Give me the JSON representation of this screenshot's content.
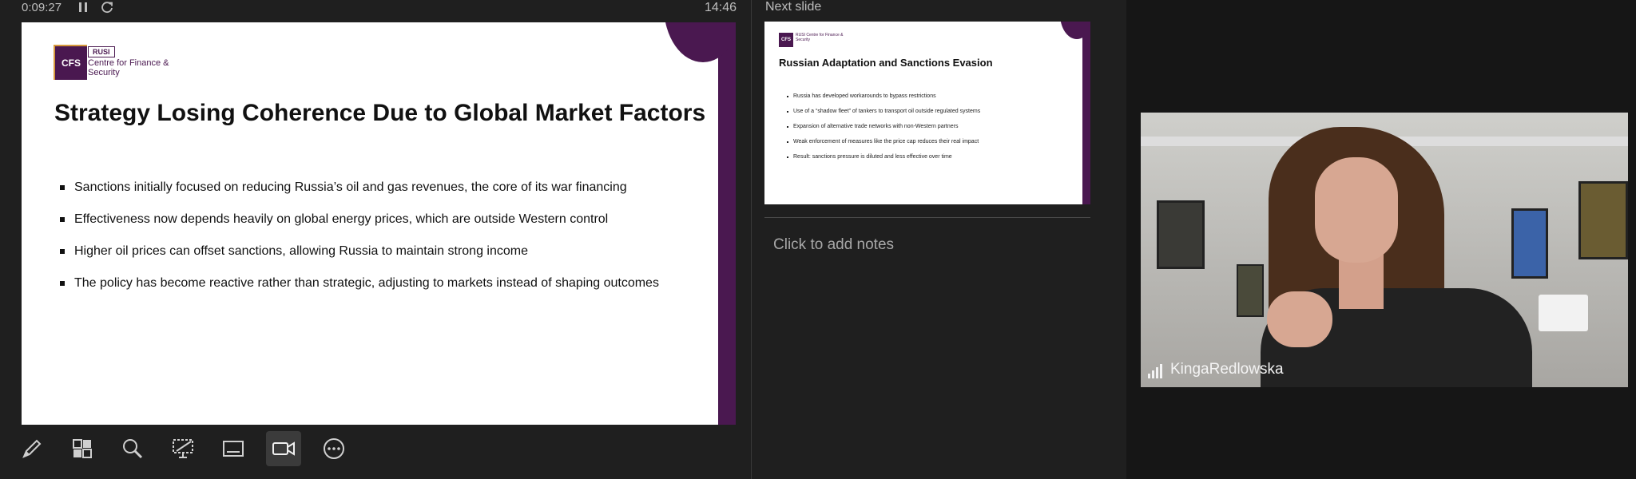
{
  "topbar": {
    "timer": "0:09:27",
    "clock": "14:46"
  },
  "current_slide": {
    "logo": {
      "mark": "CFS",
      "org": "RUSI",
      "name": "Centre for Finance & Security"
    },
    "title": "Strategy Losing Coherence Due to Global Market Factors",
    "bullets": [
      "Sanctions initially focused on reducing Russia’s oil and gas revenues, the core of its war financing",
      "Effectiveness now depends heavily on global energy prices, which are outside Western control",
      "Higher oil prices can offset sanctions, allowing Russia to maintain strong income",
      "The policy has become reactive rather than strategic, adjusting to markets instead of shaping outcomes"
    ]
  },
  "next_panel": {
    "label": "Next slide",
    "slide": {
      "logo_mark": "CFS",
      "logo_name": "RUSI Centre for Finance & Security",
      "title": "Russian Adaptation and Sanctions Evasion",
      "bullets": [
        "Russia has developed workarounds to bypass restrictions",
        "Use of a “shadow fleet” of tankers to transport oil outside regulated systems",
        "Expansion of alternative trade networks with non-Western partners",
        "Weak enforcement of measures like the price cap reduces their real impact",
        "Result: sanctions pressure is diluted and less effective over time"
      ]
    },
    "notes_placeholder": "Click to add notes"
  },
  "video": {
    "participant_name": "KingaRedlowska"
  },
  "toolbar": {
    "icons": [
      "pen-icon",
      "slides-grid-icon",
      "zoom-icon",
      "pointer-screen-icon",
      "subtitles-icon",
      "camera-icon",
      "more-options-icon"
    ],
    "active_icon": "camera-icon"
  },
  "colors": {
    "accent": "#4a1850",
    "logo_gold": "#d79a3c",
    "background": "#1f1f1f"
  }
}
